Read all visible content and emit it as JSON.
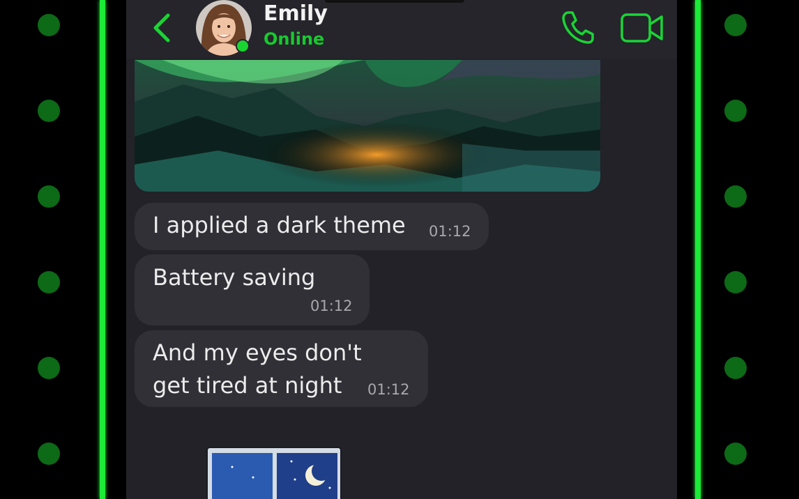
{
  "contact": {
    "name": "Emily",
    "status": "Online"
  },
  "header": {
    "back_icon": "chevron-left-icon",
    "call_icon": "phone-icon",
    "video_icon": "video-camera-icon"
  },
  "messages": [
    {
      "text": "I applied a dark theme",
      "time": "01:12"
    },
    {
      "text": "Battery saving",
      "time": "01:12"
    },
    {
      "line1": "And my eyes don't",
      "line2": "get tired at night",
      "time": "01:12"
    }
  ],
  "colors": {
    "accent": "#1bea36",
    "status_green": "#19c92f",
    "chat_bg": "#222228",
    "bubble": "#303036",
    "side_dot": "#0d6a17"
  }
}
